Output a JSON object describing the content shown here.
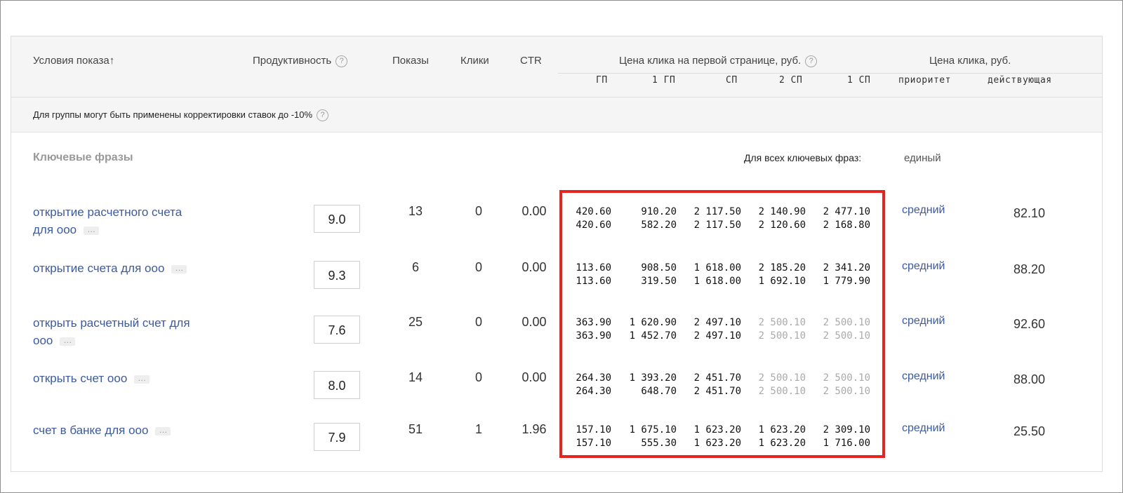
{
  "header": {
    "col_conditions": "Условия показа",
    "sort_arrow": "↑",
    "col_productivity": "Продуктивность",
    "col_impressions": "Показы",
    "col_clicks": "Клики",
    "col_ctr": "CTR",
    "col_first_page_price": "Цена клика на первой странице, руб.",
    "col_click_price": "Цена клика, руб.",
    "sub_gp": "ГП",
    "sub_1gp": "1 ГП",
    "sub_sp": "СП",
    "sub_2sp": "2 СП",
    "sub_1sp": "1 СП",
    "sub_priority": "приоритет",
    "sub_effective": "действующая",
    "help_glyph": "?"
  },
  "notice": {
    "text": "Для группы могут быть применены корректировки ставок до -10%"
  },
  "section": {
    "title": "Ключевые фразы",
    "all_label": "Для всех ключевых фраз:",
    "all_value": "единый"
  },
  "rows": [
    {
      "phrase_line1": "открытие расчетного счета",
      "phrase_line2": "для ооо",
      "score": "9.0",
      "impressions": "13",
      "clicks": "0",
      "ctr": "0.00",
      "bids_top": [
        "420.60",
        "910.20",
        "2 117.50",
        "2 140.90",
        "2 477.10"
      ],
      "bids_bottom": [
        "420.60",
        "582.20",
        "2 117.50",
        "2 120.60",
        "2 168.80"
      ],
      "gray": [
        false,
        false,
        false,
        false,
        false
      ],
      "priority": "средний",
      "effective": "82.10"
    },
    {
      "phrase_line1": "открытие счета для ооо",
      "phrase_line2": "",
      "score": "9.3",
      "impressions": "6",
      "clicks": "0",
      "ctr": "0.00",
      "bids_top": [
        "113.60",
        "908.50",
        "1 618.00",
        "2 185.20",
        "2 341.20"
      ],
      "bids_bottom": [
        "113.60",
        "319.50",
        "1 618.00",
        "1 692.10",
        "1 779.90"
      ],
      "gray": [
        false,
        false,
        false,
        false,
        false
      ],
      "priority": "средний",
      "effective": "88.20"
    },
    {
      "phrase_line1": "открыть расчетный счет для",
      "phrase_line2": "ооо",
      "score": "7.6",
      "impressions": "25",
      "clicks": "0",
      "ctr": "0.00",
      "bids_top": [
        "363.90",
        "1 620.90",
        "2 497.10",
        "2 500.10",
        "2 500.10"
      ],
      "bids_bottom": [
        "363.90",
        "1 452.70",
        "2 497.10",
        "2 500.10",
        "2 500.10"
      ],
      "gray": [
        false,
        false,
        false,
        true,
        true
      ],
      "priority": "средний",
      "effective": "92.60"
    },
    {
      "phrase_line1": "открыть счет ооо",
      "phrase_line2": "",
      "score": "8.0",
      "impressions": "14",
      "clicks": "0",
      "ctr": "0.00",
      "bids_top": [
        "264.30",
        "1 393.20",
        "2 451.70",
        "2 500.10",
        "2 500.10"
      ],
      "bids_bottom": [
        "264.30",
        "648.70",
        "2 451.70",
        "2 500.10",
        "2 500.10"
      ],
      "gray": [
        false,
        false,
        false,
        true,
        true
      ],
      "priority": "средний",
      "effective": "88.00"
    },
    {
      "phrase_line1": "счет в банке для ооо",
      "phrase_line2": "",
      "score": "7.9",
      "impressions": "51",
      "clicks": "1",
      "ctr": "1.96",
      "bids_top": [
        "157.10",
        "1 675.10",
        "1 623.20",
        "1 623.20",
        "2 309.10"
      ],
      "bids_bottom": [
        "157.10",
        "555.30",
        "1 623.20",
        "1 623.20",
        "1 716.00"
      ],
      "gray": [
        false,
        false,
        false,
        false,
        false
      ],
      "priority": "средний",
      "effective": "25.50"
    }
  ],
  "colors": {
    "link": "#3c5aa0",
    "highlight": "#e8231f",
    "muted": "#aaaaaa"
  },
  "icons": {
    "more": "ellipsis-icon",
    "help": "question-circle-icon"
  }
}
